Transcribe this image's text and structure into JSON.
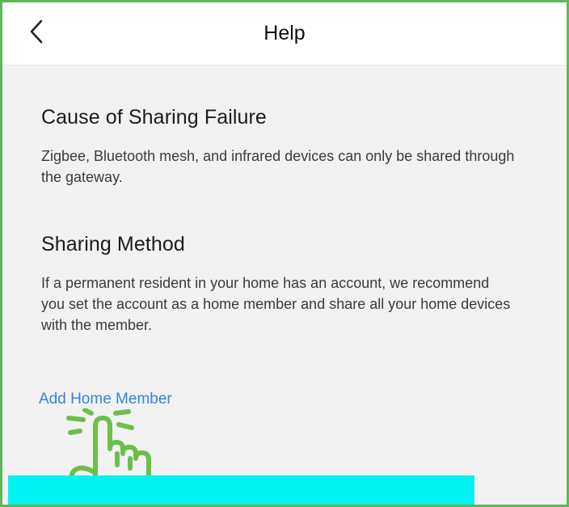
{
  "header": {
    "title": "Help",
    "back_icon": "chevron-left-icon"
  },
  "sections": [
    {
      "title": "Cause of Sharing Failure",
      "body": "Zigbee, Bluetooth mesh, and infrared devices can only be shared through the gateway."
    },
    {
      "title": "Sharing Method",
      "body": "If a permanent resident in your home has an account, we recommend you set the account as a home member and share all your home devices with the member."
    }
  ],
  "action": {
    "label": "Add Home Member",
    "color": "#2f86e0"
  },
  "annotation": {
    "icon": "tap-hand-icon",
    "color": "#6cc04a"
  },
  "colors": {
    "frame_border": "#5cb85c",
    "background": "#f2f2f2",
    "bottom_bar": "#00f2f2"
  }
}
